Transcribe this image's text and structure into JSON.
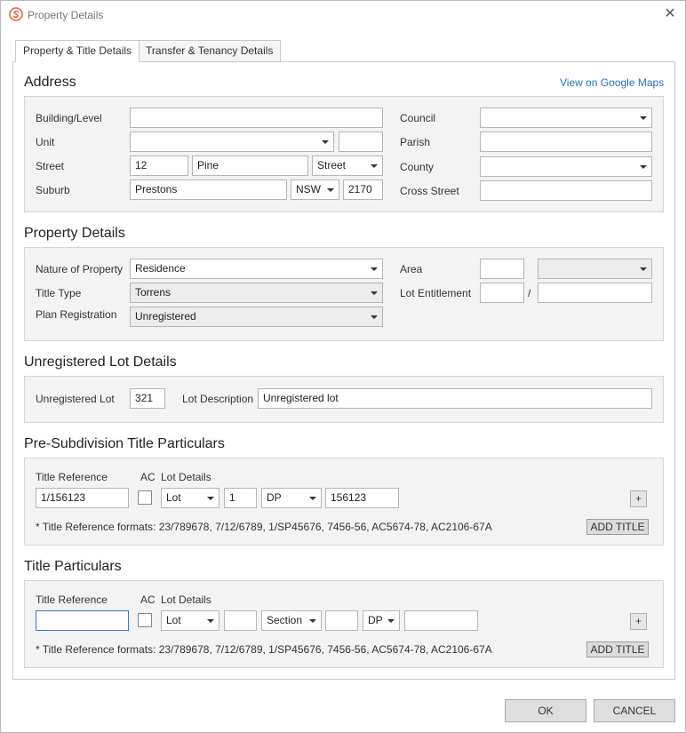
{
  "window": {
    "title": "Property Details"
  },
  "tabs": [
    {
      "label": "Property & Title Details"
    },
    {
      "label": "Transfer & Tenancy Details"
    }
  ],
  "address": {
    "title": "Address",
    "maps_link": "View on Google Maps",
    "building_label": "Building/Level",
    "building_value": "",
    "unit_label": "Unit",
    "unit_value": "",
    "unit_extra_value": "",
    "street_label": "Street",
    "street_number": "12",
    "street_name": "Pine",
    "street_type": "Street",
    "suburb_label": "Suburb",
    "suburb_value": "Prestons",
    "state_value": "NSW",
    "postcode_value": "2170",
    "council_label": "Council",
    "council_value": "",
    "parish_label": "Parish",
    "parish_value": "",
    "county_label": "County",
    "county_value": "",
    "cross_street_label": "Cross Street",
    "cross_street_value": ""
  },
  "property_details": {
    "title": "Property Details",
    "nature_label": "Nature of Property",
    "nature_value": "Residence",
    "title_type_label": "Title Type",
    "title_type_value": "Torrens",
    "plan_reg_label": "Plan Registration",
    "plan_reg_value": "Unregistered",
    "area_label": "Area",
    "area_value": "",
    "area_unit_value": "",
    "lot_entitlement_label": "Lot Entitlement",
    "lot_entitlement_a": "",
    "lot_entitlement_sep": "/",
    "lot_entitlement_b": ""
  },
  "unregistered_lot": {
    "title": "Unregistered Lot Details",
    "lot_label": "Unregistered Lot",
    "lot_value": "321",
    "desc_label": "Lot Description",
    "desc_value": "Unregistered lot"
  },
  "pre_subdivision": {
    "title": "Pre-Subdivision Title Particulars",
    "title_ref_label": "Title Reference",
    "ac_label": "AC",
    "lot_details_label": "Lot Details",
    "title_ref_value": "1/156123",
    "lot_type": "Lot",
    "lot_number": "1",
    "plan_type": "DP",
    "plan_number": "156123",
    "plus_label": "+",
    "formats_note": "* Title Reference formats: 23/789678, 7/12/6789, 1/SP45676, 7456-56, AC5674-78, AC2106-67A",
    "add_title_label": "ADD TITLE"
  },
  "title_particulars": {
    "title": "Title Particulars",
    "title_ref_label": "Title Reference",
    "ac_label": "AC",
    "lot_details_label": "Lot Details",
    "title_ref_value": "",
    "lot_type": "Lot",
    "lot_number": "",
    "section_type": "Section",
    "section_number": "",
    "plan_type": "DP",
    "plan_number": "",
    "plus_label": "+",
    "formats_note": "* Title Reference formats: 23/789678, 7/12/6789, 1/SP45676, 7456-56, AC5674-78, AC2106-67A",
    "add_title_label": "ADD TITLE"
  },
  "footer": {
    "ok_label": "OK",
    "cancel_label": "CANCEL"
  },
  "colors": {
    "accent": "#2a6fbf",
    "app_icon": "#e8643c"
  }
}
